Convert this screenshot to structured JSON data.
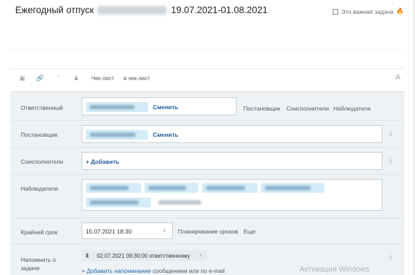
{
  "task": {
    "title_prefix": "Ежегодный отпуск",
    "title_dates": "19.07.2021-01.08.2021",
    "important_label": "Это важная задача"
  },
  "toolbar": {
    "checklist": "Чек-лист",
    "to_checklist": "в чек-лист",
    "format": "A"
  },
  "fields": {
    "responsible": {
      "label": "Ответственный",
      "change": "Сменить"
    },
    "creator": {
      "label": "Постановщик",
      "change": "Сменить"
    },
    "assistants": {
      "label": "Соисполнители",
      "add": "+ Добавить"
    },
    "observers": {
      "label": "Наблюдатели"
    },
    "deadline": {
      "label": "Крайний срок",
      "value": "15.07.2021 18:30",
      "planning": "Планирование сроков",
      "more": "Еще"
    },
    "remind": {
      "label_line1": "Напомнить о",
      "label_line2": "задаче",
      "reminder": "02.07.2021 09:30:00 ответственному",
      "add_link": "+ Добавить напоминание",
      "add_rest": "сообщением или по e-mail"
    }
  },
  "role_options": [
    "Постановщик",
    "Соисполнители",
    "Наблюдатели"
  ],
  "watermark": "Активация Windows",
  "icons": [
    "video-icon",
    "link-icon",
    "quote-icon",
    "user-icon",
    "pin-icon",
    "flame-icon",
    "bell-icon",
    "clear-icon"
  ]
}
